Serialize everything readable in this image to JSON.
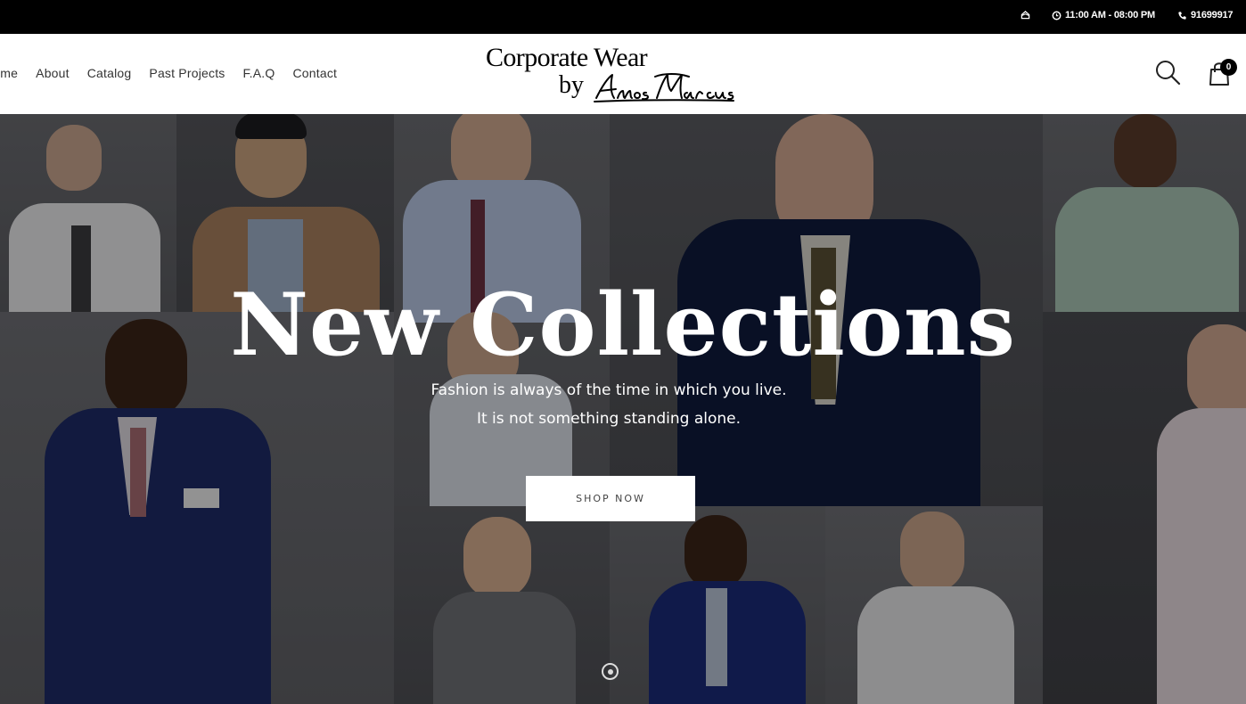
{
  "topbar": {
    "home_icon": "home-icon",
    "hours": "11:00 AM - 08:00 PM",
    "clock_icon": "clock-icon",
    "phone": "91699917",
    "phone_icon": "phone-icon"
  },
  "nav": {
    "items": [
      "Home",
      "About",
      "Catalog",
      "Past Projects",
      "F.A.Q",
      "Contact"
    ]
  },
  "logo": {
    "line1": "Corporate Wear",
    "line2": "by"
  },
  "header": {
    "search_icon": "search-icon",
    "cart_icon": "shopping-bag-icon",
    "cart_count": "0"
  },
  "hero": {
    "title": "New Collections",
    "subtitle_line1": "Fashion is always of the time in which you live.",
    "subtitle_line2": "It is not something standing alone.",
    "button_label": "SHOP NOW",
    "slide_indicator": "slide-dot-icon"
  },
  "colors": {
    "topbar_bg": "#000000",
    "header_bg": "#ffffff",
    "hero_text": "#ffffff",
    "button_bg": "#ffffff"
  }
}
